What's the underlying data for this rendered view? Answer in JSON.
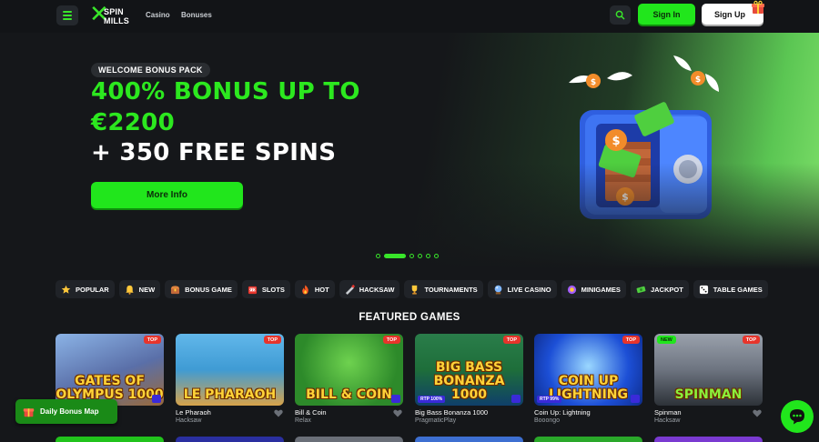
{
  "header": {
    "logo_line1": "SPIN",
    "logo_line2": "MILLS",
    "nav": [
      "Casino",
      "Bonuses"
    ],
    "signin_label": "Sign In",
    "signup_label": "Sign Up"
  },
  "hero": {
    "pill": "WELCOME BONUS PACK",
    "line1": "400% BONUS UP TO",
    "line2": "€2200",
    "line3": "+ 350 FREE SPINS",
    "cta": "More Info",
    "slides": 6,
    "active_slide": 1
  },
  "categories": [
    {
      "label": "POPULAR",
      "icon": "star-icon"
    },
    {
      "label": "NEW",
      "icon": "bell-icon"
    },
    {
      "label": "BONUS GAME",
      "icon": "chest-icon"
    },
    {
      "label": "SLOTS",
      "icon": "slot-machine-icon"
    },
    {
      "label": "HOT",
      "icon": "fire-icon"
    },
    {
      "label": "HACKSAW",
      "icon": "saw-icon"
    },
    {
      "label": "TOURNAMENTS",
      "icon": "trophy-icon"
    },
    {
      "label": "LIVE CASINO",
      "icon": "crystal-ball-icon"
    },
    {
      "label": "MINIGAMES",
      "icon": "controller-icon"
    },
    {
      "label": "JACKPOT",
      "icon": "money-icon"
    },
    {
      "label": "TABLE GAMES",
      "icon": "dice-icon"
    }
  ],
  "featured_title": "FEATURED GAMES",
  "games": [
    {
      "art": "GATES OF OLYMPUS 1000",
      "name": "1000",
      "provider": "",
      "tag": "TOP",
      "rtp": "",
      "bg": "#5a6fa8"
    },
    {
      "art": "LE PHARAOH",
      "name": "Le Pharaoh",
      "provider": "Hacksaw",
      "tag": "TOP",
      "rtp": "",
      "bg": "#3f9bd4"
    },
    {
      "art": "BILL & COIN",
      "name": "Bill & Coin",
      "provider": "Relax",
      "tag": "TOP",
      "rtp": "",
      "bg": "#2d8a2a"
    },
    {
      "art": "BIG BASS BONANZA 1000",
      "name": "Big Bass Bonanza 1000",
      "provider": "PragmaticPlay",
      "tag": "TOP",
      "rtp": "RTP 100%",
      "bg": "#1e6e3a"
    },
    {
      "art": "COIN UP LIGHTNING",
      "name": "Coin Up: Lightning",
      "provider": "Booongo",
      "tag": "TOP",
      "rtp": "RTP 99%",
      "bg": "#1c4fd6"
    },
    {
      "art": "SPINMAN",
      "name": "Spinman",
      "provider": "Hacksaw",
      "tag": "TOP",
      "new": "NEW",
      "rtp": "",
      "bg": "#6d7480"
    }
  ],
  "bonus_map_label": "Daily Bonus Map",
  "colors": {
    "accent": "#21e61c",
    "background": "#15171a",
    "tag_red": "#e7342b"
  }
}
